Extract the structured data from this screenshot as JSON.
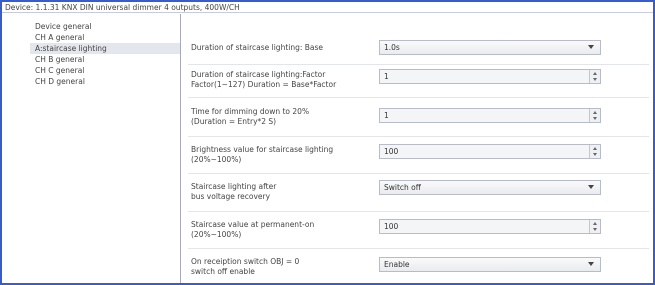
{
  "window": {
    "title": "Device: 1.1.31  KNX DIN universal dimmer 4 outputs, 400W/CH"
  },
  "sidebar": {
    "items": [
      {
        "label": "Device general"
      },
      {
        "label": "CH A general"
      },
      {
        "label": "A:staircase lighting",
        "selected": true
      },
      {
        "label": "CH B general"
      },
      {
        "label": "CH C general"
      },
      {
        "label": "CH D general"
      }
    ]
  },
  "params": {
    "p1": {
      "label": "Duration of staircase lighting: Base",
      "value": "1.0s",
      "control": "select"
    },
    "p2": {
      "label_line1": "Duration of staircase lighting:Factor",
      "label_line2": "Factor(1~127)  Duration = Base*Factor",
      "value": "1",
      "control": "spinner"
    },
    "p3": {
      "label_line1": "Time for dimming down to 20%",
      "label_line2": "(Duration = Entry*2 S)",
      "value": "1",
      "control": "spinner"
    },
    "p4": {
      "label_line1": "Brightness value for staircase lighting",
      "label_line2": "(20%~100%)",
      "value": "100",
      "control": "spinner"
    },
    "p5": {
      "label_line1": "Staircase lighting after",
      "label_line2": "bus voltage recovery",
      "value": "Switch off",
      "control": "select"
    },
    "p6": {
      "label_line1": "Staircase value at permanent-on",
      "label_line2": "(20%~100%)",
      "value": "100",
      "control": "spinner"
    },
    "p7": {
      "label_line1": "On receiption switch OBJ = 0",
      "label_line2": "switch off enable",
      "value": "Enable",
      "control": "select"
    }
  }
}
